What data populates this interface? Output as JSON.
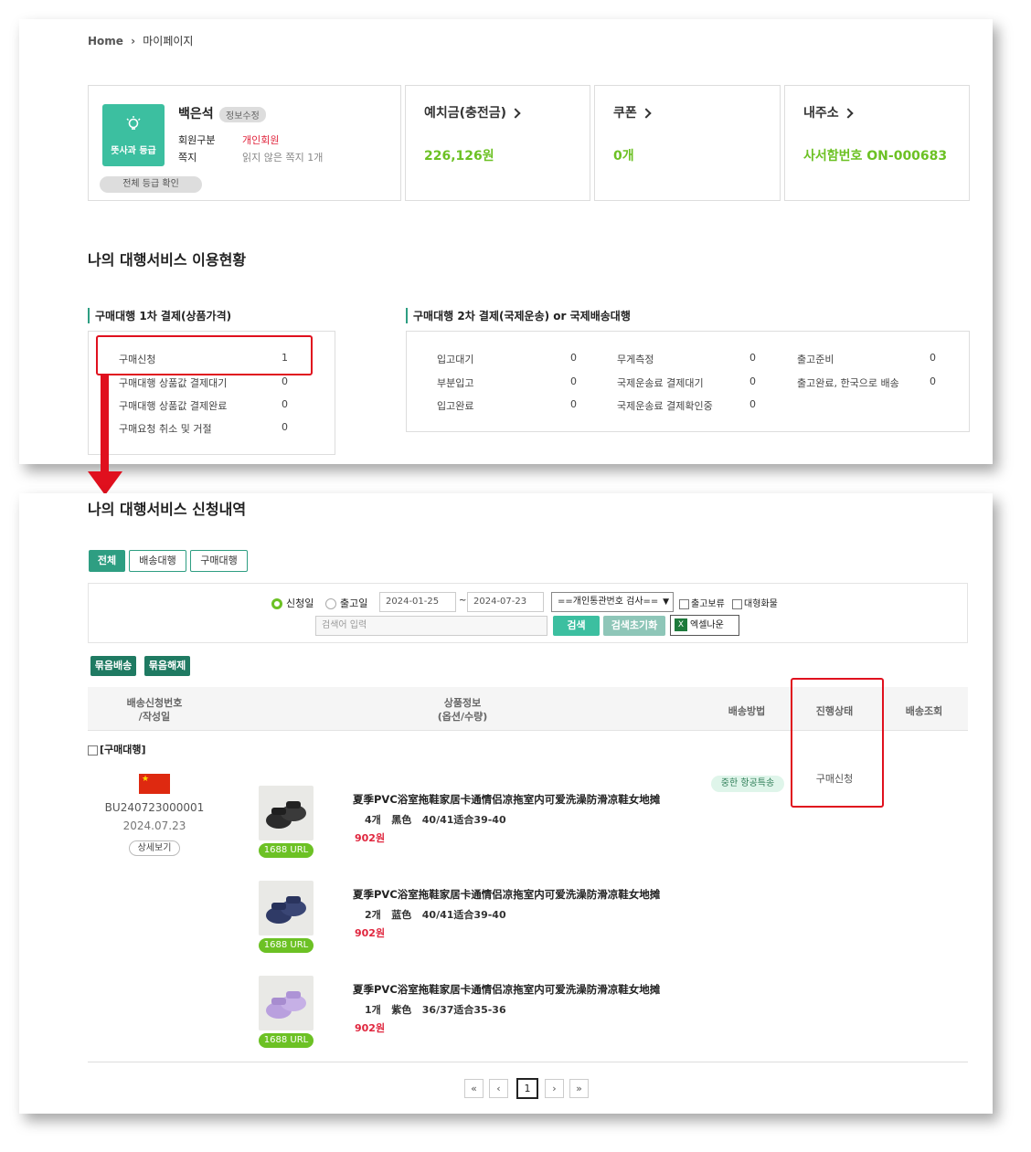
{
  "breadcrumb": {
    "home": "Home",
    "current": "마이페이지"
  },
  "profile": {
    "grade_label": "뜻사과 등급",
    "name": "백은석",
    "edit_label": "정보수정",
    "member_type_label": "회원구분",
    "member_type_value": "개인회원",
    "note_label": "쪽지",
    "note_value": "읽지 않은 쪽지 1개",
    "all_grade_label": "전체 등급 확인"
  },
  "cards": [
    {
      "title": "예치금(충전금)",
      "value": "226,126원"
    },
    {
      "title": "쿠폰",
      "value": "0개"
    },
    {
      "title": "내주소",
      "value": "사서함번호 ON-000683"
    }
  ],
  "usage": {
    "title": "나의 대행서비스 이용현황",
    "section1_title": "구매대행 1차 결제(상품가격)",
    "section1_rows": [
      {
        "label": "구매신청",
        "count": "1"
      },
      {
        "label": "구매대행 상품값 결제대기",
        "count": "0"
      },
      {
        "label": "구매대행 상품값 결제완료",
        "count": "0"
      },
      {
        "label": "구매요청 취소 및 거절",
        "count": "0"
      }
    ],
    "section2_title": "구매대행 2차 결제(국제운송) or 국제배송대행",
    "section2_cols": [
      [
        {
          "label": "입고대기",
          "count": "0"
        },
        {
          "label": "부분입고",
          "count": "0"
        },
        {
          "label": "입고완료",
          "count": "0"
        }
      ],
      [
        {
          "label": "무게측정",
          "count": "0"
        },
        {
          "label": "국제운송료 결제대기",
          "count": "0"
        },
        {
          "label": "국제운송료 결제확인중",
          "count": "0"
        }
      ],
      [
        {
          "label": "출고준비",
          "count": "0"
        },
        {
          "label": "출고완료, 한국으로 배송",
          "count": "0"
        }
      ]
    ]
  },
  "history": {
    "title": "나의 대행서비스 신청내역",
    "tabs": [
      "전체",
      "배송대행",
      "구매대행"
    ],
    "filter": {
      "radio_apply": "신청일",
      "radio_ship": "출고일",
      "date_from": "2024-01-25",
      "date_sep": "~",
      "date_to": "2024-07-23",
      "select_value": "==개인통관번호 검사==",
      "check_hold": "출고보류",
      "check_large": "대형화물",
      "search_placeholder": "검색어 입력",
      "search_button": "검색",
      "reset_button": "검색초기화",
      "excel_button": "엑셀나운"
    },
    "bundle_buttons": [
      "묶음배송",
      "묶음해제"
    ],
    "columns": [
      "배송신청번호\n/작성일",
      "상품정보\n(옵션/수량)",
      "배송방법",
      "진행상태",
      "배송조회"
    ],
    "group_label": "[구매대행]",
    "order": {
      "number": "BU240723000001",
      "date": "2024.07.23",
      "detail_button": "상세보기",
      "shipping_method": "중한 항공특송",
      "status": "구매신청"
    },
    "items": [
      {
        "title": "夏季PVC浴室拖鞋家居卡通情侣凉拖室内可爱洗澡防滑凉鞋女地摊",
        "qty": "4개",
        "color": "黑色",
        "size": "40/41适合39-40",
        "price": "902원",
        "url_label": "1688 URL",
        "swatch": "#2b2b2b"
      },
      {
        "title": "夏季PVC浴室拖鞋家居卡通情侣凉拖室内可爱洗澡防滑凉鞋女地摊",
        "qty": "2개",
        "color": "蓝色",
        "size": "40/41适合39-40",
        "price": "902원",
        "url_label": "1688 URL",
        "swatch": "#2f3a66"
      },
      {
        "title": "夏季PVC浴室拖鞋家居卡通情侣凉拖室内可爱洗澡防滑凉鞋女地摊",
        "qty": "1개",
        "color": "紫色",
        "size": "36/37适合35-36",
        "price": "902원",
        "url_label": "1688 URL",
        "swatch": "#b9a0de"
      }
    ],
    "pagination": {
      "first": "«",
      "prev": "‹",
      "current": "1",
      "next": "›",
      "last": "»"
    }
  },
  "colors": {
    "accent_green": "#6cc124",
    "teal": "#2e9e82",
    "red": "#e0253d",
    "highlight": "#e0101e"
  }
}
